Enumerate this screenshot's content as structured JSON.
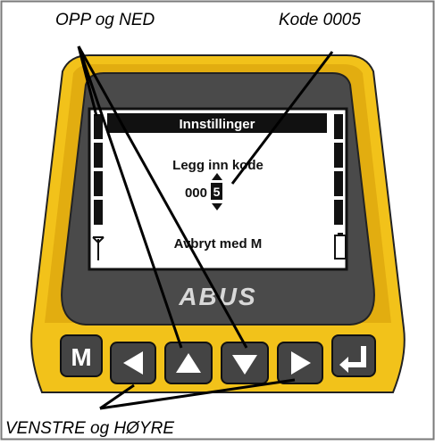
{
  "callouts": {
    "up_down": "OPP og NED",
    "code": "Kode 0005",
    "left_right": "VENSTRE og HØYRE"
  },
  "screen": {
    "title": "Innstillinger",
    "prompt": "Legg inn kode",
    "code_prefix": "000",
    "code_digit": "5",
    "footer": "Avbryt med M"
  },
  "device": {
    "brand": "ABUS",
    "body_color": "#f2c21a",
    "bezel_color": "#4a4a4a"
  },
  "keypad": {
    "m_label": "M",
    "keys": [
      "menu",
      "left",
      "up",
      "down",
      "right",
      "enter"
    ]
  }
}
